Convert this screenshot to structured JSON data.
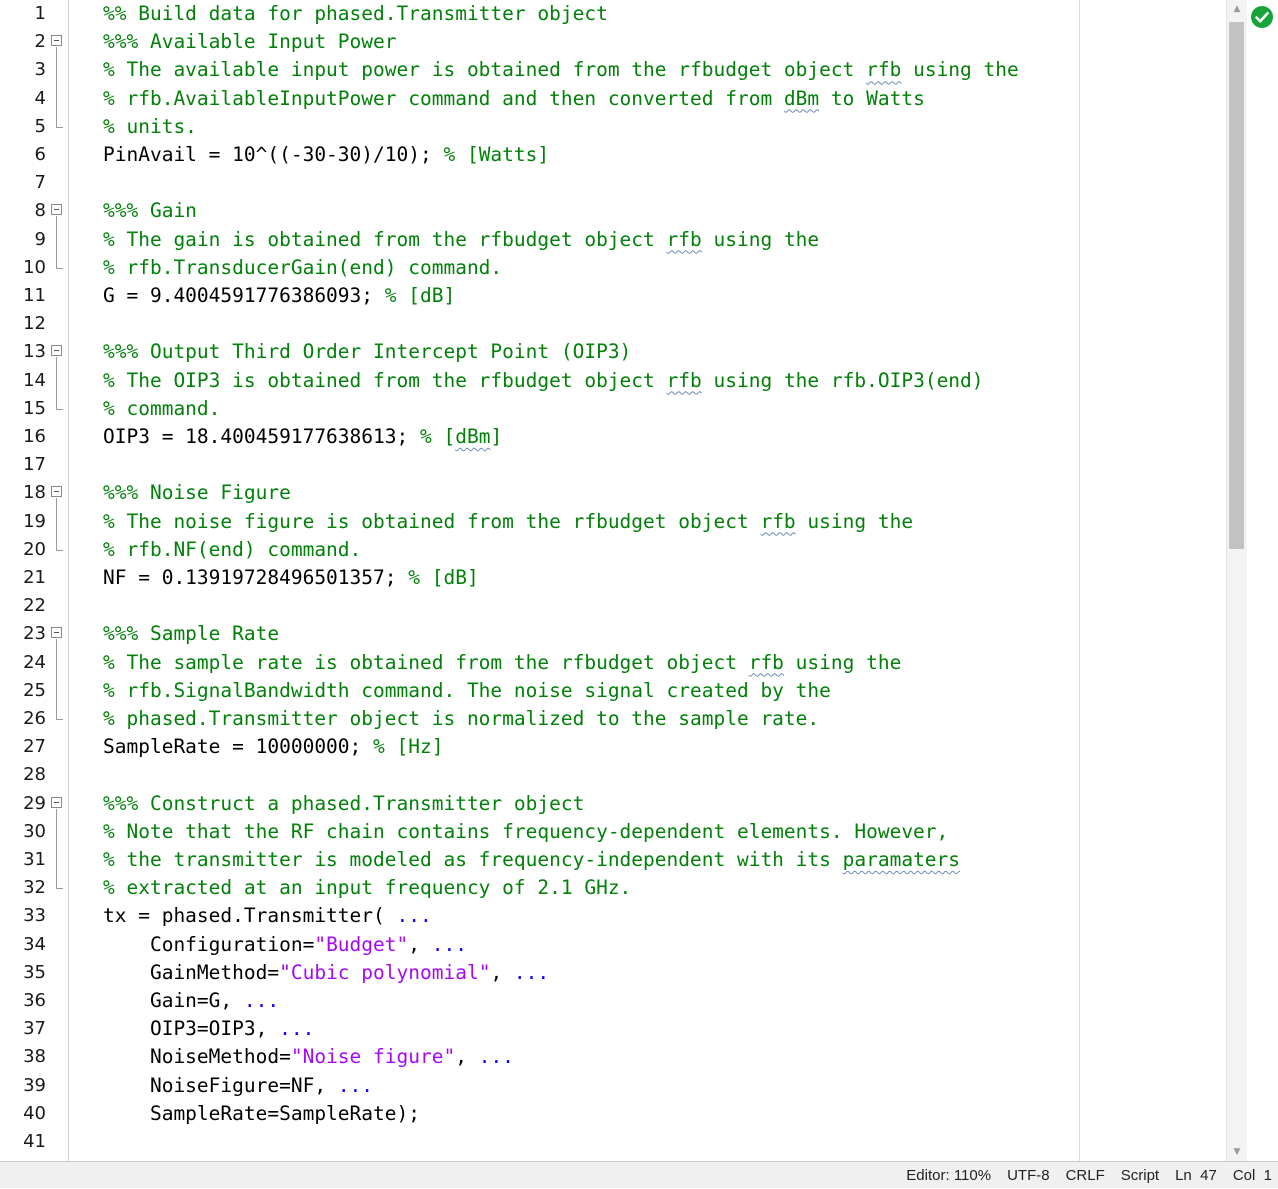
{
  "editor": {
    "lines": [
      {
        "n": "1",
        "fold": "",
        "tokens": [
          {
            "t": "%% Build data for phased.Transmitter object",
            "c": "comment"
          }
        ]
      },
      {
        "n": "2",
        "fold": "start",
        "tokens": [
          {
            "t": "%%% Available Input Power",
            "c": "comment"
          }
        ]
      },
      {
        "n": "3",
        "fold": "mid",
        "tokens": [
          {
            "t": "% The available input power is obtained from the rfbudget object ",
            "c": "comment"
          },
          {
            "t": "rfb",
            "c": "comment",
            "sq": true
          },
          {
            "t": " using the",
            "c": "comment"
          }
        ]
      },
      {
        "n": "4",
        "fold": "mid",
        "tokens": [
          {
            "t": "% rfb.AvailableInputPower command and then converted from ",
            "c": "comment"
          },
          {
            "t": "dBm",
            "c": "comment",
            "sq": true
          },
          {
            "t": " to Watts",
            "c": "comment"
          }
        ]
      },
      {
        "n": "5",
        "fold": "end",
        "tokens": [
          {
            "t": "% units.",
            "c": "comment"
          }
        ]
      },
      {
        "n": "6",
        "fold": "",
        "tokens": [
          {
            "t": "PinAvail = 10^((-30-30)/10); ",
            "c": "default"
          },
          {
            "t": "% [Watts]",
            "c": "comment"
          }
        ]
      },
      {
        "n": "7",
        "fold": "",
        "tokens": []
      },
      {
        "n": "8",
        "fold": "start",
        "tokens": [
          {
            "t": "%%% Gain",
            "c": "comment"
          }
        ]
      },
      {
        "n": "9",
        "fold": "mid",
        "tokens": [
          {
            "t": "% The gain is obtained from the rfbudget object ",
            "c": "comment"
          },
          {
            "t": "rfb",
            "c": "comment",
            "sq": true
          },
          {
            "t": " using the",
            "c": "comment"
          }
        ]
      },
      {
        "n": "10",
        "fold": "end",
        "tokens": [
          {
            "t": "% rfb.TransducerGain(end) command.",
            "c": "comment"
          }
        ]
      },
      {
        "n": "11",
        "fold": "",
        "tokens": [
          {
            "t": "G = 9.4004591776386093; ",
            "c": "default"
          },
          {
            "t": "% [dB]",
            "c": "comment"
          }
        ]
      },
      {
        "n": "12",
        "fold": "",
        "tokens": []
      },
      {
        "n": "13",
        "fold": "start",
        "tokens": [
          {
            "t": "%%% Output Third Order Intercept Point (OIP3)",
            "c": "comment"
          }
        ]
      },
      {
        "n": "14",
        "fold": "mid",
        "tokens": [
          {
            "t": "% The OIP3 is obtained from the rfbudget object ",
            "c": "comment"
          },
          {
            "t": "rfb",
            "c": "comment",
            "sq": true
          },
          {
            "t": " using the rfb.OIP3(end)",
            "c": "comment"
          }
        ]
      },
      {
        "n": "15",
        "fold": "end",
        "tokens": [
          {
            "t": "% command.",
            "c": "comment"
          }
        ]
      },
      {
        "n": "16",
        "fold": "",
        "tokens": [
          {
            "t": "OIP3 = 18.400459177638613; ",
            "c": "default"
          },
          {
            "t": "% [",
            "c": "comment"
          },
          {
            "t": "dBm",
            "c": "comment",
            "sq": true
          },
          {
            "t": "]",
            "c": "comment"
          }
        ]
      },
      {
        "n": "17",
        "fold": "",
        "tokens": []
      },
      {
        "n": "18",
        "fold": "start",
        "tokens": [
          {
            "t": "%%% Noise Figure",
            "c": "comment"
          }
        ]
      },
      {
        "n": "19",
        "fold": "mid",
        "tokens": [
          {
            "t": "% The noise figure is obtained from the rfbudget object ",
            "c": "comment"
          },
          {
            "t": "rfb",
            "c": "comment",
            "sq": true
          },
          {
            "t": " using the",
            "c": "comment"
          }
        ]
      },
      {
        "n": "20",
        "fold": "end",
        "tokens": [
          {
            "t": "% rfb.NF(end) command.",
            "c": "comment"
          }
        ]
      },
      {
        "n": "21",
        "fold": "",
        "tokens": [
          {
            "t": "NF = 0.13919728496501357; ",
            "c": "default"
          },
          {
            "t": "% [dB]",
            "c": "comment"
          }
        ]
      },
      {
        "n": "22",
        "fold": "",
        "tokens": []
      },
      {
        "n": "23",
        "fold": "start",
        "tokens": [
          {
            "t": "%%% Sample Rate",
            "c": "comment"
          }
        ]
      },
      {
        "n": "24",
        "fold": "mid",
        "tokens": [
          {
            "t": "% The sample rate is obtained from the rfbudget object ",
            "c": "comment"
          },
          {
            "t": "rfb",
            "c": "comment",
            "sq": true
          },
          {
            "t": " using the",
            "c": "comment"
          }
        ]
      },
      {
        "n": "25",
        "fold": "mid",
        "tokens": [
          {
            "t": "% rfb.SignalBandwidth command. The noise signal created by the",
            "c": "comment"
          }
        ]
      },
      {
        "n": "26",
        "fold": "end",
        "tokens": [
          {
            "t": "% phased.Transmitter object is normalized to the sample rate.",
            "c": "comment"
          }
        ]
      },
      {
        "n": "27",
        "fold": "",
        "tokens": [
          {
            "t": "SampleRate = 10000000; ",
            "c": "default"
          },
          {
            "t": "% [Hz]",
            "c": "comment"
          }
        ]
      },
      {
        "n": "28",
        "fold": "",
        "tokens": []
      },
      {
        "n": "29",
        "fold": "start",
        "tokens": [
          {
            "t": "%%% Construct a phased.Transmitter object",
            "c": "comment"
          }
        ]
      },
      {
        "n": "30",
        "fold": "mid",
        "tokens": [
          {
            "t": "% Note that the RF chain contains frequency-dependent elements. However,",
            "c": "comment"
          }
        ]
      },
      {
        "n": "31",
        "fold": "mid",
        "tokens": [
          {
            "t": "% the transmitter is modeled as frequency-independent with its ",
            "c": "comment"
          },
          {
            "t": "paramaters",
            "c": "comment",
            "sq": true
          }
        ]
      },
      {
        "n": "32",
        "fold": "end",
        "tokens": [
          {
            "t": "% extracted at an input frequency of 2.1 GHz.",
            "c": "comment"
          }
        ]
      },
      {
        "n": "33",
        "fold": "",
        "tokens": [
          {
            "t": "tx = phased.Transmitter( ",
            "c": "default"
          },
          {
            "t": "...",
            "c": "cont"
          }
        ]
      },
      {
        "n": "34",
        "fold": "",
        "tokens": [
          {
            "t": "    Configuration=",
            "c": "default"
          },
          {
            "t": "\"Budget\"",
            "c": "string"
          },
          {
            "t": ", ",
            "c": "default"
          },
          {
            "t": "...",
            "c": "cont"
          }
        ]
      },
      {
        "n": "35",
        "fold": "",
        "tokens": [
          {
            "t": "    GainMethod=",
            "c": "default"
          },
          {
            "t": "\"Cubic polynomial\"",
            "c": "string"
          },
          {
            "t": ", ",
            "c": "default"
          },
          {
            "t": "...",
            "c": "cont"
          }
        ]
      },
      {
        "n": "36",
        "fold": "",
        "tokens": [
          {
            "t": "    Gain=G, ",
            "c": "default"
          },
          {
            "t": "...",
            "c": "cont"
          }
        ]
      },
      {
        "n": "37",
        "fold": "",
        "tokens": [
          {
            "t": "    OIP3=OIP3, ",
            "c": "default"
          },
          {
            "t": "...",
            "c": "cont"
          }
        ]
      },
      {
        "n": "38",
        "fold": "",
        "tokens": [
          {
            "t": "    NoiseMethod=",
            "c": "default"
          },
          {
            "t": "\"Noise figure\"",
            "c": "string"
          },
          {
            "t": ", ",
            "c": "default"
          },
          {
            "t": "...",
            "c": "cont"
          }
        ]
      },
      {
        "n": "39",
        "fold": "",
        "tokens": [
          {
            "t": "    NoiseFigure=NF, ",
            "c": "default"
          },
          {
            "t": "...",
            "c": "cont"
          }
        ]
      },
      {
        "n": "40",
        "fold": "",
        "tokens": [
          {
            "t": "    SampleRate=SampleRate);",
            "c": "default"
          }
        ]
      },
      {
        "n": "41",
        "fold": "",
        "tokens": []
      }
    ]
  },
  "icons": {
    "analyzer": "check-circle-icon",
    "scroll_up": "scroll-up-arrow-icon",
    "scroll_down": "scroll-down-arrow-icon"
  },
  "scroll": {
    "position": 0,
    "visible_fraction": 0.45
  },
  "status": {
    "zoom": "Editor: 110%",
    "encoding": "UTF-8",
    "line_ending": "CRLF",
    "file_type": "Script",
    "line": "Ln  47",
    "col": "Col  1"
  },
  "colors": {
    "comment": "#028009",
    "default": "#000000",
    "string": "#a709f5",
    "cont": "#0e00ff",
    "analyzer_ok": "#15a33a"
  }
}
